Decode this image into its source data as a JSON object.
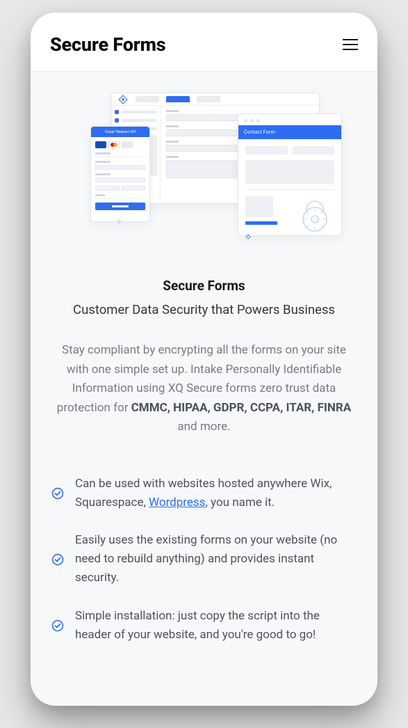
{
  "header": {
    "title": "Secure Forms"
  },
  "illustration": {
    "payment_title": "Visual *Redirect API",
    "contact_title": "Contact Form"
  },
  "hero": {
    "title": "Secure Forms",
    "subtitle": "Customer Data Security that Powers Business",
    "description_pre": "Stay compliant by encrypting all the forms on your site with one simple set up. Intake Personally Identifiable Information using XQ Secure forms zero trust data protection for ",
    "description_strong": "CMMC, HIPAA, GDPR, CCPA, ITAR, FINRA",
    "description_post": " and more."
  },
  "features": [
    {
      "pre": "Can be used with websites hosted anywhere Wix, Squarespace, ",
      "link": "Wordpress",
      "post": ", you name it."
    },
    {
      "pre": "Easily uses the existing forms on your website (no need to rebuild anything) and provides instant security.",
      "link": "",
      "post": ""
    },
    {
      "pre": "Simple installation: just copy the script into the header of your website, and you're good to go!",
      "link": "",
      "post": ""
    }
  ]
}
